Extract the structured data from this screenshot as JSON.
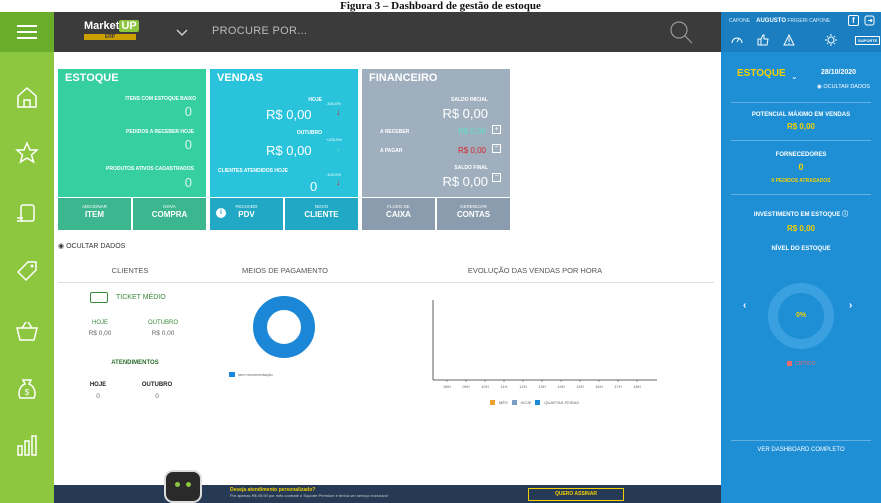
{
  "caption": "Figura 3 – Dashboard de gestão de estoque",
  "header": {
    "logo_text": "Market",
    "logo_up": "UP",
    "logo_sub": "ERP",
    "search_placeholder": "PROCURE POR..."
  },
  "sidebar": {
    "items": [
      "menu-icon",
      "home-icon",
      "star-icon",
      "products-icon",
      "tag-icon",
      "basket-icon",
      "money-bag-icon",
      "chart-icon"
    ]
  },
  "tiles": {
    "estoque": {
      "title": "ESTOQUE",
      "rows": [
        {
          "label": "ITENS COM ESTOQUE BAIXO",
          "value": "0"
        },
        {
          "label": "PEDIDOS A RECEBER HOJE",
          "value": "0"
        },
        {
          "label": "PRODUTOS ATIVOS CADASTRADOS",
          "value": "0"
        }
      ],
      "btn1_sub": "ADICIONAR",
      "btn1": "ITEM",
      "btn2_sub": "NOVA",
      "btn2": "COMPRA"
    },
    "vendas": {
      "title": "VENDAS",
      "hoje_label": "HOJE",
      "hoje_value": "R$ 0,00",
      "hoje_pct": "-100,0%",
      "outubro_label": "OUTUBRO",
      "outubro_value": "R$ 0,00",
      "outubro_pct": "+100,0%",
      "clientes_label": "CLIENTES ATENDIDOS HOJE",
      "clientes_value": "0",
      "clientes_pct": "-100,0%",
      "btn1_sub": "FECHADO",
      "btn1": "PDV",
      "btn2_sub": "NOVO",
      "btn2": "CLIENTE"
    },
    "financeiro": {
      "title": "FINANCEIRO",
      "saldo_inicial_label": "SALDO INICIAL",
      "saldo_inicial_value": "R$ 0,00",
      "receber_label": "A RECEBER",
      "receber_value": "R$ 0,00",
      "pagar_label": "A PAGAR",
      "pagar_value": "R$ 0,00",
      "saldo_final_label": "SALDO FINAL",
      "saldo_final_value": "R$ 0,00",
      "btn1_sub": "FLUXO DE",
      "btn1": "CAIXA",
      "btn2_sub": "GERENCIAR",
      "btn2": "CONTAS"
    }
  },
  "hide_data": "OCULTAR DADOS",
  "clientes": {
    "title": "CLIENTES",
    "ticket": "TICKET MÉDIO",
    "hoje_label": "HOJE",
    "hoje_value": "R$ 0,00",
    "outubro_label": "OUTUBRO",
    "outubro_value": "R$ 0,00",
    "atend_title": "ATENDIMENTOS",
    "atend_hoje_label": "HOJE",
    "atend_hoje_value": "0",
    "atend_out_label": "OUTUBRO",
    "atend_out_value": "0"
  },
  "pagamento": {
    "title": "MEIOS DE PAGAMENTO",
    "legend": "sem movimentação"
  },
  "evolucao": {
    "title": "EVOLUÇÃO DAS VENDAS POR HORA",
    "hours": [
      "08H",
      "09H",
      "10H",
      "11H",
      "12H",
      "13H",
      "14H",
      "15H",
      "16H",
      "17H",
      "18H"
    ],
    "legend": [
      "MÊS",
      "HOJE",
      "QUARTAS-FEIRAS"
    ]
  },
  "right": {
    "user_prefix": "CAPONE",
    "user_name": "AUGUSTO",
    "user_rest": "FRIGERI CAPONE",
    "support": "SUPORTE",
    "section": "ESTOQUE",
    "date": "28/10/2020",
    "hide": "OCULTAR DADOS",
    "potencial_title": "POTENCIAL MÁXIMO EM VENDAS",
    "potencial_value": "R$ 0,00",
    "forn_title": "FORNECEDORES",
    "forn_value": "0",
    "forn_sub": "0 PEDIDOS ATRASADOS",
    "invest_title": "INVESTIMENTO EM ESTOQUE",
    "invest_value": "R$ 0,00",
    "nivel_title": "NÍVEL DO ESTOQUE",
    "gauge_pct": "0%",
    "gauge_fraction": 0,
    "critico": "CRÍTICO",
    "link": "VER DASHBOARD COMPLETO"
  },
  "footer": {
    "text1": "Deseja atendimento personalizado?",
    "text2": "Por apenas R$ 49,90 por mês contrate o Suporte Premium e tenha um serviço exclusivo!",
    "button": "QUERO ASSINAR"
  },
  "colors": {
    "green": "#8dc63f",
    "teal": "#36cfa0",
    "cyan": "#29c4dc",
    "gray": "#9fafbe",
    "blue": "#1e8fd5"
  }
}
